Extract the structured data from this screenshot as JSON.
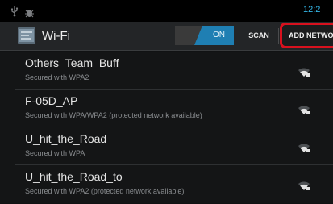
{
  "status_bar": {
    "clock": "12:2",
    "icons": [
      "usb-icon",
      "debug-icon"
    ]
  },
  "action_bar": {
    "title": "Wi-Fi",
    "app_icon": "wifi-settings-icon",
    "toggle": {
      "state": "ON",
      "label": "ON"
    },
    "scan_label": "SCAN",
    "add_network_label": "ADD NETWORK",
    "highlight_color": "#d8111e",
    "accent_color": "#33b5e5"
  },
  "networks": [
    {
      "ssid": "Others_Team_Buff",
      "security": "Secured with WPA2"
    },
    {
      "ssid": "F-05D_AP",
      "security": "Secured with WPA/WPA2 (protected network available)"
    },
    {
      "ssid": "U_hit_the_Road",
      "security": "Secured with WPA"
    },
    {
      "ssid": "U_hit_the_Road_to",
      "security": "Secured with WPA2 (protected network available)"
    }
  ]
}
